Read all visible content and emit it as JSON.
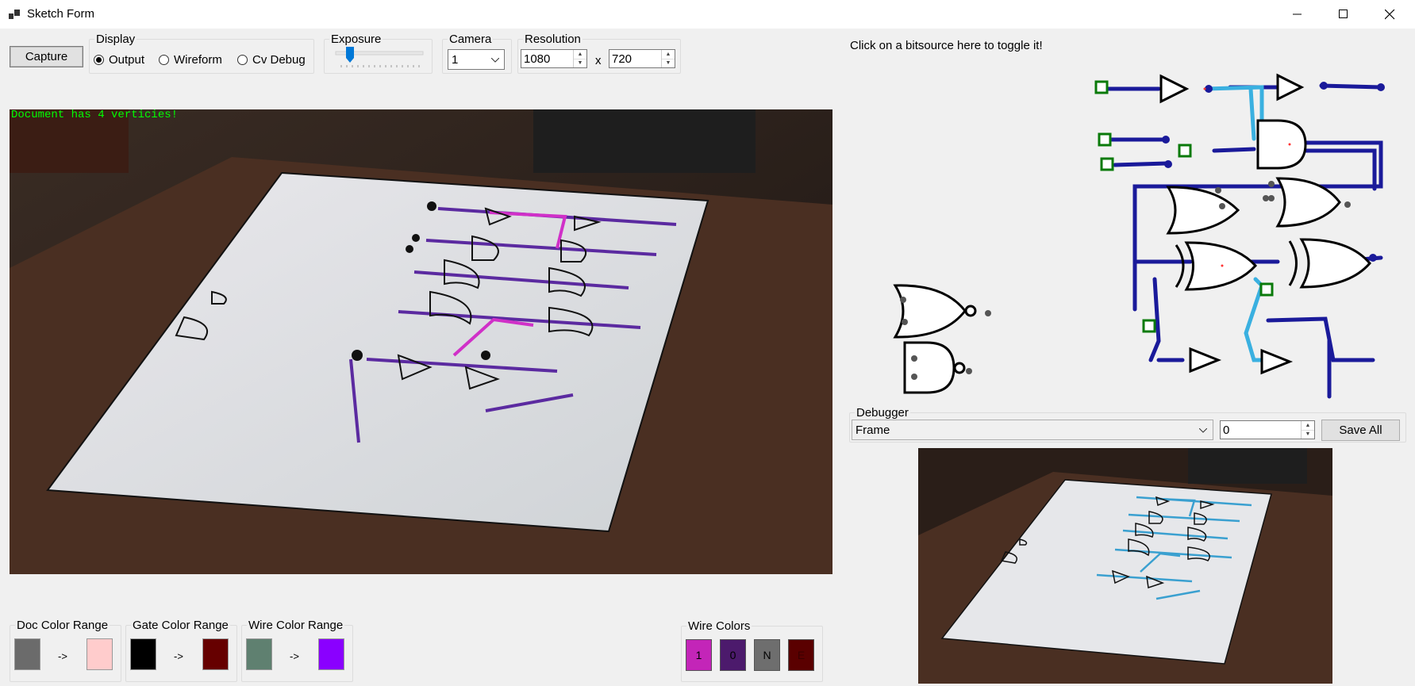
{
  "window": {
    "title": "Sketch Form",
    "minimize_icon": "minimize-icon",
    "maximize_icon": "maximize-icon",
    "close_icon": "close-icon"
  },
  "toolbar": {
    "capture_label": "Capture",
    "display": {
      "legend": "Display",
      "options": [
        "Output",
        "Wireform",
        "Cv Debug"
      ],
      "selected": "Output"
    },
    "exposure": {
      "legend": "Exposure",
      "level": 0.2
    },
    "camera": {
      "legend": "Camera",
      "value": "1"
    },
    "resolution": {
      "legend": "Resolution",
      "width": "1080",
      "separator": "x",
      "height": "720"
    }
  },
  "main_view": {
    "overlay_text": "Document has 4 verticies!",
    "overlay_color": "#00ff00"
  },
  "hint_text": "Click on a bitsource here to toggle it!",
  "debugger": {
    "legend": "Debugger",
    "selected": "Frame",
    "frame_value": "0",
    "save_label": "Save All"
  },
  "color_ranges": [
    {
      "legend": "Doc Color Range",
      "from": "#6b6b6b",
      "arrow": "->",
      "to": "#ffcccc"
    },
    {
      "legend": "Gate Color Range",
      "from": "#000000",
      "arrow": "->",
      "to": "#660000"
    },
    {
      "legend": "Wire Color Range",
      "from": "#5f8070",
      "arrow": "->",
      "to": "#8a00ff"
    }
  ],
  "wire_colors": {
    "legend": "Wire Colors",
    "items": [
      {
        "label": "1",
        "color": "#c325b8"
      },
      {
        "label": "0",
        "color": "#4c1a6c"
      },
      {
        "label": "N",
        "color": "#6e6e6e"
      },
      {
        "label": "E",
        "color": "#5a0000"
      }
    ]
  }
}
